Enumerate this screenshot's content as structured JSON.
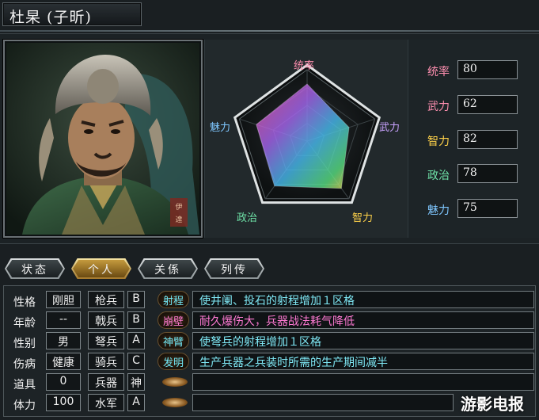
{
  "title": "杜杲 (子昕)",
  "radar": {
    "labels": {
      "tongshuai": "统率",
      "wuli": "武力",
      "zhili": "智力",
      "zhengzhi": "政治",
      "meili": "魅力"
    },
    "values": [
      80,
      62,
      82,
      78,
      75
    ],
    "colors": {
      "tongshuai": "#ff8fb0",
      "wuli": "#c9a3ff",
      "zhili": "#ffd24a",
      "zhengzhi": "#6fe3a8",
      "meili": "#7fc7ff"
    }
  },
  "stats": [
    {
      "label": "统率",
      "value": "80",
      "color": "#ff8fb0"
    },
    {
      "label": "武力",
      "value": "62",
      "color": "#ff8fb0"
    },
    {
      "label": "智力",
      "value": "82",
      "color": "#ffd24a"
    },
    {
      "label": "政治",
      "value": "78",
      "color": "#6fe3a8"
    },
    {
      "label": "魅力",
      "value": "75",
      "color": "#7fc7ff"
    }
  ],
  "portrait": {
    "seal_text": "伊達"
  },
  "tabs": [
    {
      "label": "状态",
      "active": false
    },
    {
      "label": "个人",
      "active": true
    },
    {
      "label": "关係",
      "active": false
    },
    {
      "label": "列传",
      "active": false
    }
  ],
  "attributes": [
    {
      "label": "性格",
      "value": "刚胆"
    },
    {
      "label": "年龄",
      "value": "--"
    },
    {
      "label": "性别",
      "value": "男"
    },
    {
      "label": "伤病",
      "value": "健康"
    },
    {
      "label": "道具",
      "value": "0"
    },
    {
      "label": "体力",
      "value": "100"
    }
  ],
  "aptitudes": [
    {
      "label": "枪兵",
      "grade": "B"
    },
    {
      "label": "戟兵",
      "grade": "B"
    },
    {
      "label": "弩兵",
      "grade": "A"
    },
    {
      "label": "骑兵",
      "grade": "C"
    },
    {
      "label": "兵器",
      "grade": "神"
    },
    {
      "label": "水军",
      "grade": "A"
    }
  ],
  "skills": [
    {
      "name": "射程",
      "desc": "使井阑、投石的射程增加１区格",
      "name_color": "#6fe3f0",
      "desc_color": "#7fe8f5"
    },
    {
      "name": "崩壁",
      "desc": "耐久爆伤大，兵器战法耗气降低",
      "name_color": "#ff79d0",
      "desc_color": "#ff7ad4"
    },
    {
      "name": "神臂",
      "desc": "使弩兵的射程增加１区格",
      "name_color": "#6fe3f0",
      "desc_color": "#7fe8f5"
    },
    {
      "name": "发明",
      "desc": "生产兵器之兵装时所需的生产期间减半",
      "name_color": "#6fe3f0",
      "desc_color": "#7fe8f5"
    }
  ],
  "watermark": "游影电报"
}
